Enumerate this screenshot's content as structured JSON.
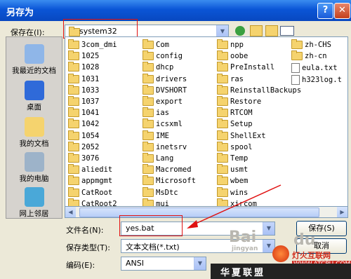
{
  "window": {
    "title": "另存为",
    "help": "?",
    "close": "✕"
  },
  "lookin": {
    "label": "保存在(I):",
    "value": "system32"
  },
  "toolbar": {
    "icons": [
      "back-icon",
      "up-folder-icon",
      "new-folder-icon",
      "views-icon"
    ]
  },
  "places": [
    {
      "label": "我最近的文档"
    },
    {
      "label": "桌面"
    },
    {
      "label": "我的文档"
    },
    {
      "label": "我的电脑"
    },
    {
      "label": "网上邻居"
    }
  ],
  "files": {
    "col1": [
      "3com_dmi",
      "1025",
      "1028",
      "1031",
      "1033",
      "1037",
      "1041",
      "1042",
      "1054",
      "2052",
      "3076",
      "aliedit",
      "appmgmt",
      "CatRoot",
      "CatRoot2"
    ],
    "col2": [
      "Com",
      "config",
      "dhcp",
      "drivers",
      "DVSHORT",
      "export",
      "ias",
      "icsxml",
      "IME",
      "inetsrv",
      "Lang",
      "Macromed",
      "Microsoft",
      "MsDtc",
      "mui"
    ],
    "col3": [
      "npp",
      "oobe",
      "PreInstall",
      "ras",
      "ReinstallBackups",
      "Restore",
      "RTCOM",
      "Setup",
      "ShellExt",
      "spool",
      "Temp",
      "usmt",
      "wbem",
      "wins",
      "xircom"
    ],
    "col4": [
      {
        "name": "zh-CHS",
        "type": "folder"
      },
      {
        "name": "zh-cn",
        "type": "folder"
      },
      {
        "name": "eula.txt",
        "type": "txt"
      },
      {
        "name": "h323log.t",
        "type": "txt"
      }
    ]
  },
  "filename": {
    "label": "文件名(N):",
    "value": "yes.bat"
  },
  "filetype": {
    "label": "保存类型(T):",
    "value": "文本文档(*.txt)"
  },
  "encoding": {
    "label": "编码(E):",
    "value": "ANSI"
  },
  "buttons": {
    "save": "保存(S)",
    "cancel": "取消"
  },
  "watermark": {
    "bai": "Bai",
    "jingyan": "jingyan",
    "du": "du"
  },
  "footer": {
    "hx": "华夏联盟",
    "site_cn": "灯火互联网",
    "site_url": "WWW.ATCPU.COM"
  },
  "colors": {
    "highlight": "#e01010",
    "title_bar": "#0a55d6"
  }
}
